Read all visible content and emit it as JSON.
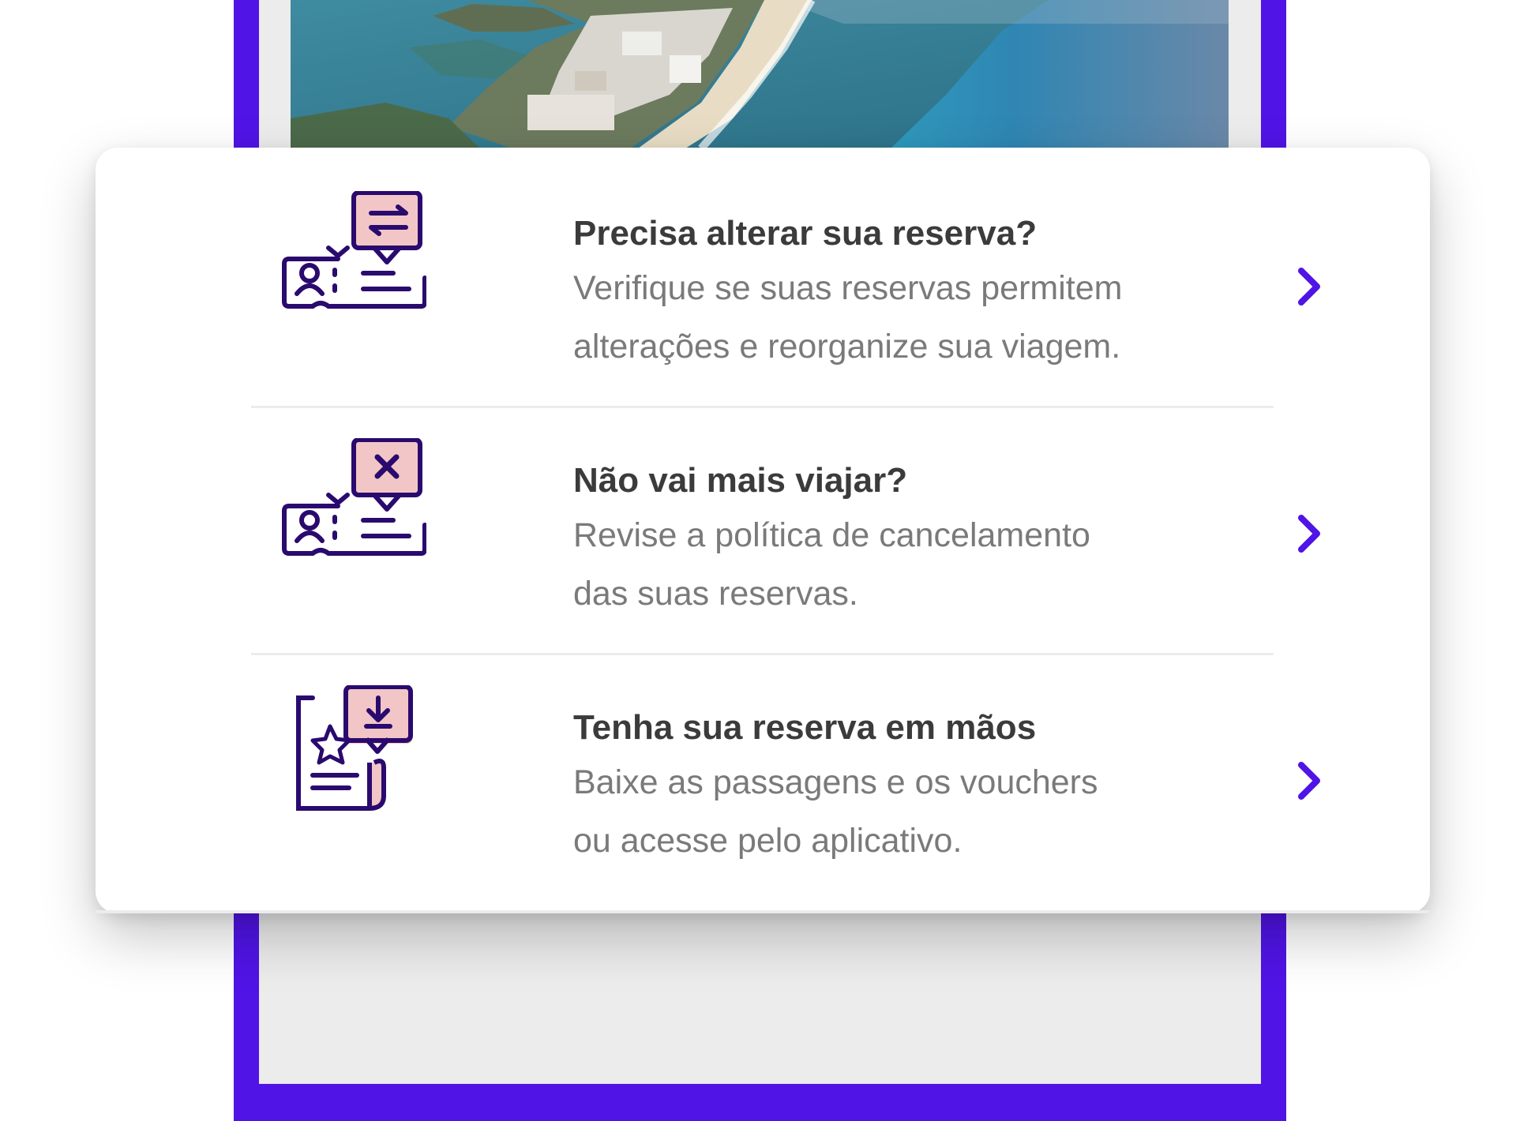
{
  "colors": {
    "accent": "#5014e6",
    "icon_stroke": "#2a0a6e",
    "icon_fill": "#f2c6c6",
    "title_text": "#3b3b3b",
    "desc_text": "#7a7a7a"
  },
  "hero": {
    "image": "aerial-beach-city-photo"
  },
  "options": [
    {
      "icon": "change-booking-icon",
      "title": "Precisa alterar sua reserva?",
      "desc_line1": "Verifique se suas reservas permitem",
      "desc_line2": "alterações e reorganize sua viagem."
    },
    {
      "icon": "cancel-booking-icon",
      "title": "Não vai mais viajar?",
      "desc_line1": "Revise a política de cancelamento",
      "desc_line2": "das suas reservas."
    },
    {
      "icon": "download-voucher-icon",
      "title": "Tenha sua reserva em mãos",
      "desc_line1": "Baixe as passagens e os vouchers",
      "desc_line2": "ou acesse pelo aplicativo."
    }
  ]
}
